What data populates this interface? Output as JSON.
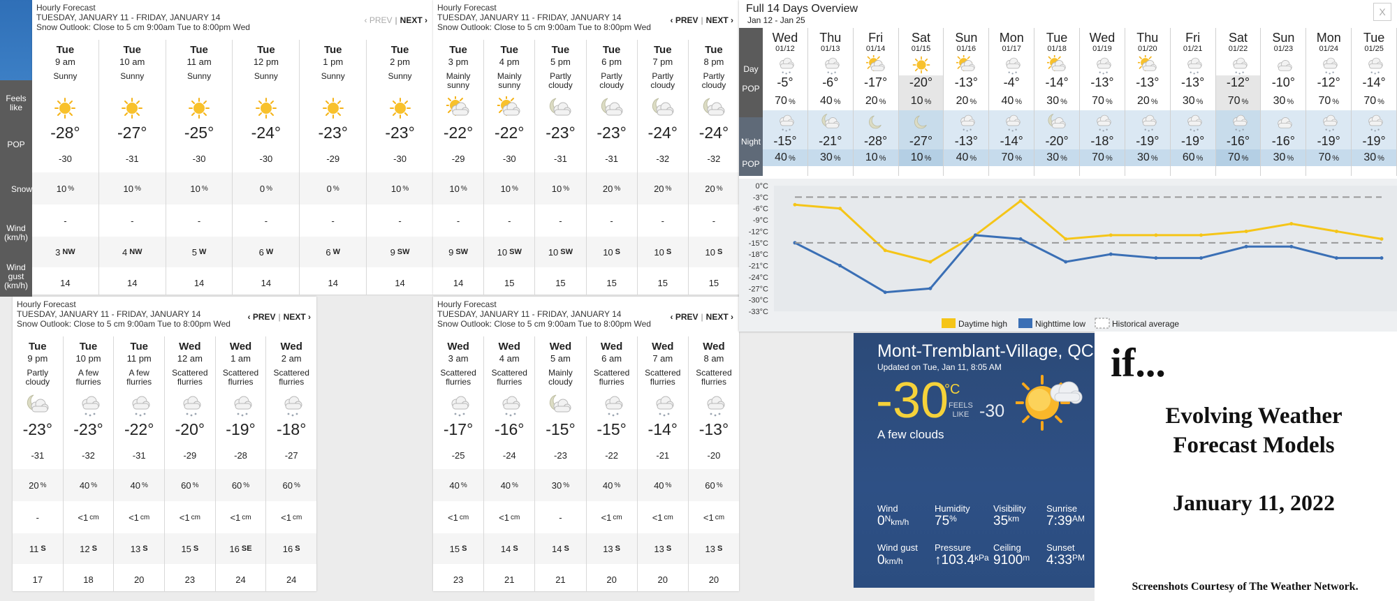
{
  "hourly_panels": [
    {
      "title": "Hourly Forecast",
      "range": "TUESDAY, JANUARY 11 - FRIDAY, JANUARY 14",
      "outlook": "Snow Outlook: Close to 5 cm 9:00am Tue to 8:00pm Wed",
      "prev": "‹ PREV",
      "sep": "|",
      "next": "NEXT ›",
      "hours": [
        {
          "day": "Tue",
          "time": "9 am",
          "cond": "Sunny",
          "icon": "sun-icon",
          "temp": "-28°",
          "feels": "-30",
          "pop": "10",
          "snow": "-",
          "wind_speed": "3",
          "wind_dir": "NW",
          "gust": "14"
        },
        {
          "day": "Tue",
          "time": "10 am",
          "cond": "Sunny",
          "icon": "sun-icon",
          "temp": "-27°",
          "feels": "-31",
          "pop": "10",
          "snow": "-",
          "wind_speed": "4",
          "wind_dir": "NW",
          "gust": "14"
        },
        {
          "day": "Tue",
          "time": "11 am",
          "cond": "Sunny",
          "icon": "sun-icon",
          "temp": "-25°",
          "feels": "-30",
          "pop": "10",
          "snow": "-",
          "wind_speed": "5",
          "wind_dir": "W",
          "gust": "14"
        },
        {
          "day": "Tue",
          "time": "12 pm",
          "cond": "Sunny",
          "icon": "sun-icon",
          "temp": "-24°",
          "feels": "-30",
          "pop": "0",
          "snow": "-",
          "wind_speed": "6",
          "wind_dir": "W",
          "gust": "14"
        },
        {
          "day": "Tue",
          "time": "1 pm",
          "cond": "Sunny",
          "icon": "sun-icon",
          "temp": "-23°",
          "feels": "-29",
          "pop": "0",
          "snow": "-",
          "wind_speed": "6",
          "wind_dir": "W",
          "gust": "14"
        },
        {
          "day": "Tue",
          "time": "2 pm",
          "cond": "Sunny",
          "icon": "sun-icon",
          "temp": "-23°",
          "feels": "-30",
          "pop": "10",
          "snow": "-",
          "wind_speed": "9",
          "wind_dir": "SW",
          "gust": "14"
        }
      ]
    },
    {
      "title": "Hourly Forecast",
      "range": "TUESDAY, JANUARY 11 - FRIDAY, JANUARY 14",
      "outlook": "Snow Outlook: Close to 5 cm 9:00am Tue to 8:00pm Wed",
      "prev": "‹ PREV",
      "sep": "|",
      "next": "NEXT ›",
      "hours": [
        {
          "day": "Tue",
          "time": "3 pm",
          "cond": "Mainly sunny",
          "icon": "sun-cloud-icon",
          "temp": "-22°",
          "feels": "-29",
          "pop": "10",
          "snow": "-",
          "wind_speed": "9",
          "wind_dir": "SW",
          "gust": "14"
        },
        {
          "day": "Tue",
          "time": "4 pm",
          "cond": "Mainly sunny",
          "icon": "sun-cloud-icon",
          "temp": "-22°",
          "feels": "-30",
          "pop": "10",
          "snow": "-",
          "wind_speed": "10",
          "wind_dir": "SW",
          "gust": "15"
        },
        {
          "day": "Tue",
          "time": "5 pm",
          "cond": "Partly cloudy",
          "icon": "moon-cloud-icon",
          "temp": "-23°",
          "feels": "-31",
          "pop": "10",
          "snow": "-",
          "wind_speed": "10",
          "wind_dir": "SW",
          "gust": "15"
        },
        {
          "day": "Tue",
          "time": "6 pm",
          "cond": "Partly cloudy",
          "icon": "moon-cloud-icon",
          "temp": "-23°",
          "feels": "-31",
          "pop": "20",
          "snow": "-",
          "wind_speed": "10",
          "wind_dir": "S",
          "gust": "15"
        },
        {
          "day": "Tue",
          "time": "7 pm",
          "cond": "Partly cloudy",
          "icon": "moon-cloud-icon",
          "temp": "-24°",
          "feels": "-32",
          "pop": "20",
          "snow": "-",
          "wind_speed": "10",
          "wind_dir": "S",
          "gust": "15"
        },
        {
          "day": "Tue",
          "time": "8 pm",
          "cond": "Partly cloudy",
          "icon": "moon-cloud-icon",
          "temp": "-24°",
          "feels": "-32",
          "pop": "20",
          "snow": "-",
          "wind_speed": "10",
          "wind_dir": "S",
          "gust": "15"
        }
      ]
    },
    {
      "title": "Hourly Forecast",
      "range": "TUESDAY, JANUARY 11 - FRIDAY, JANUARY 14",
      "outlook": "Snow Outlook: Close to 5 cm 9:00am Tue to 8:00pm Wed",
      "prev": "‹ PREV",
      "sep": "|",
      "next": "NEXT ›",
      "hours": [
        {
          "day": "Tue",
          "time": "9 pm",
          "cond": "Partly cloudy",
          "icon": "moon-cloud-icon",
          "temp": "-23°",
          "feels": "-31",
          "pop": "20",
          "snow": "-",
          "wind_speed": "11",
          "wind_dir": "S",
          "gust": "17"
        },
        {
          "day": "Tue",
          "time": "10 pm",
          "cond": "A few flurries",
          "icon": "snow-cloud-icon",
          "temp": "-23°",
          "feels": "-32",
          "pop": "40",
          "snow": "<1",
          "wind_speed": "12",
          "wind_dir": "S",
          "gust": "18"
        },
        {
          "day": "Tue",
          "time": "11 pm",
          "cond": "A few flurries",
          "icon": "snow-cloud-icon",
          "temp": "-22°",
          "feels": "-31",
          "pop": "40",
          "snow": "<1",
          "wind_speed": "13",
          "wind_dir": "S",
          "gust": "20"
        },
        {
          "day": "Wed",
          "time": "12 am",
          "cond": "Scattered flurries",
          "icon": "snow-cloud-icon",
          "temp": "-20°",
          "feels": "-29",
          "pop": "60",
          "snow": "<1",
          "wind_speed": "15",
          "wind_dir": "S",
          "gust": "23"
        },
        {
          "day": "Wed",
          "time": "1 am",
          "cond": "Scattered flurries",
          "icon": "snow-cloud-icon",
          "temp": "-19°",
          "feels": "-28",
          "pop": "60",
          "snow": "<1",
          "wind_speed": "16",
          "wind_dir": "SE",
          "gust": "24"
        },
        {
          "day": "Wed",
          "time": "2 am",
          "cond": "Scattered flurries",
          "icon": "snow-cloud-icon",
          "temp": "-18°",
          "feels": "-27",
          "pop": "60",
          "snow": "<1",
          "wind_speed": "16",
          "wind_dir": "S",
          "gust": "24"
        }
      ]
    },
    {
      "title": "Hourly Forecast",
      "range": "TUESDAY, JANUARY 11 - FRIDAY, JANUARY 14",
      "outlook": "Snow Outlook: Close to 5 cm 9:00am Tue to 8:00pm Wed",
      "prev": "‹ PREV",
      "sep": "|",
      "next": "NEXT ›",
      "hours": [
        {
          "day": "Wed",
          "time": "3 am",
          "cond": "Scattered flurries",
          "icon": "snow-cloud-icon",
          "temp": "-17°",
          "feels": "-25",
          "pop": "40",
          "snow": "<1",
          "wind_speed": "15",
          "wind_dir": "S",
          "gust": "23"
        },
        {
          "day": "Wed",
          "time": "4 am",
          "cond": "Scattered flurries",
          "icon": "snow-cloud-icon",
          "temp": "-16°",
          "feels": "-24",
          "pop": "40",
          "snow": "<1",
          "wind_speed": "14",
          "wind_dir": "S",
          "gust": "21"
        },
        {
          "day": "Wed",
          "time": "5 am",
          "cond": "Mainly cloudy",
          "icon": "moon-cloud-icon",
          "temp": "-15°",
          "feels": "-23",
          "pop": "30",
          "snow": "-",
          "wind_speed": "14",
          "wind_dir": "S",
          "gust": "21"
        },
        {
          "day": "Wed",
          "time": "6 am",
          "cond": "Scattered flurries",
          "icon": "snow-cloud-icon",
          "temp": "-15°",
          "feels": "-22",
          "pop": "40",
          "snow": "<1",
          "wind_speed": "13",
          "wind_dir": "S",
          "gust": "20"
        },
        {
          "day": "Wed",
          "time": "7 am",
          "cond": "Scattered flurries",
          "icon": "snow-cloud-icon",
          "temp": "-14°",
          "feels": "-21",
          "pop": "40",
          "snow": "<1",
          "wind_speed": "13",
          "wind_dir": "S",
          "gust": "20"
        },
        {
          "day": "Wed",
          "time": "8 am",
          "cond": "Scattered flurries",
          "icon": "snow-cloud-icon",
          "temp": "-13°",
          "feels": "-20",
          "pop": "60",
          "snow": "<1",
          "wind_speed": "13",
          "wind_dir": "S",
          "gust": "20"
        }
      ]
    }
  ],
  "units": {
    "pct": "%",
    "snow": "cm"
  },
  "row_labels": {
    "feels": "Feels like",
    "pop": "POP",
    "snow": "Snow",
    "wind": "Wind (km/h)",
    "gust": "Wind gust (km/h)"
  },
  "overview": {
    "title": "Full 14 Days Overview",
    "range": "Jan 12 - Jan 25",
    "close": "X",
    "labels": {
      "day": "Day",
      "pop": "POP",
      "night": "Night",
      "npop": "POP"
    },
    "days": [
      {
        "name": "Wed",
        "date": "01/12",
        "dicon": "snow-cloud-icon",
        "high": "-5°",
        "dpop": "70",
        "nicon": "snow-cloud-icon",
        "low": "-15°",
        "npop": "40"
      },
      {
        "name": "Thu",
        "date": "01/13",
        "dicon": "snow-cloud-icon",
        "high": "-6°",
        "dpop": "40",
        "nicon": "moon-cloud-icon",
        "low": "-21°",
        "npop": "30"
      },
      {
        "name": "Fri",
        "date": "01/14",
        "dicon": "sun-cloud-icon",
        "high": "-17°",
        "dpop": "20",
        "nicon": "moon-icon",
        "low": "-28°",
        "npop": "10"
      },
      {
        "name": "Sat",
        "date": "01/15",
        "dicon": "sun-icon",
        "high": "-20°",
        "dpop": "10",
        "nicon": "moon-icon",
        "low": "-27°",
        "npop": "10"
      },
      {
        "name": "Sun",
        "date": "01/16",
        "dicon": "sun-cloud-icon",
        "high": "-13°",
        "dpop": "20",
        "nicon": "snow-cloud-icon",
        "low": "-13°",
        "npop": "40"
      },
      {
        "name": "Mon",
        "date": "01/17",
        "dicon": "snow-cloud-icon",
        "high": "-4°",
        "dpop": "40",
        "nicon": "snow-cloud-icon",
        "low": "-14°",
        "npop": "70"
      },
      {
        "name": "Tue",
        "date": "01/18",
        "dicon": "sun-cloud-icon",
        "high": "-14°",
        "dpop": "30",
        "nicon": "moon-cloud-icon",
        "low": "-20°",
        "npop": "30"
      },
      {
        "name": "Wed",
        "date": "01/19",
        "dicon": "snow-cloud-icon",
        "high": "-13°",
        "dpop": "70",
        "nicon": "snow-cloud-icon",
        "low": "-18°",
        "npop": "70"
      },
      {
        "name": "Thu",
        "date": "01/20",
        "dicon": "sun-cloud-icon",
        "high": "-13°",
        "dpop": "20",
        "nicon": "snow-cloud-icon",
        "low": "-19°",
        "npop": "30"
      },
      {
        "name": "Fri",
        "date": "01/21",
        "dicon": "snow-cloud-icon",
        "high": "-13°",
        "dpop": "30",
        "nicon": "snow-cloud-icon",
        "low": "-19°",
        "npop": "60"
      },
      {
        "name": "Sat",
        "date": "01/22",
        "dicon": "snow-cloud-icon",
        "high": "-12°",
        "dpop": "70",
        "nicon": "snow-cloud-icon",
        "low": "-16°",
        "npop": "70"
      },
      {
        "name": "Sun",
        "date": "01/23",
        "dicon": "cloud-icon",
        "high": "-10°",
        "dpop": "30",
        "nicon": "cloud-icon",
        "low": "-16°",
        "npop": "30"
      },
      {
        "name": "Mon",
        "date": "01/24",
        "dicon": "snow-cloud-icon",
        "high": "-12°",
        "dpop": "70",
        "nicon": "snow-cloud-icon",
        "low": "-19°",
        "npop": "70"
      },
      {
        "name": "Tue",
        "date": "01/25",
        "dicon": "snow-cloud-icon",
        "high": "-14°",
        "dpop": "70",
        "nicon": "snow-cloud-icon",
        "low": "-19°",
        "npop": "30"
      }
    ]
  },
  "chart_data": {
    "type": "line",
    "x": [
      "01/12",
      "01/13",
      "01/14",
      "01/15",
      "01/16",
      "01/17",
      "01/18",
      "01/19",
      "01/20",
      "01/21",
      "01/22",
      "01/23",
      "01/24",
      "01/25"
    ],
    "series": [
      {
        "name": "Daytime high",
        "color": "#f5c518",
        "values": [
          -5,
          -6,
          -17,
          -20,
          -13,
          -4,
          -14,
          -13,
          -13,
          -13,
          -12,
          -10,
          -12,
          -14
        ]
      },
      {
        "name": "Nighttime low",
        "color": "#3a6fb5",
        "values": [
          -15,
          -21,
          -28,
          -27,
          -13,
          -14,
          -20,
          -18,
          -19,
          -19,
          -16,
          -16,
          -19,
          -19
        ]
      },
      {
        "name": "Historical average",
        "color": "#999999",
        "values": [
          -3,
          -3,
          -3,
          -3,
          -3,
          -3,
          -3,
          -3,
          -3,
          -3,
          -3,
          -3,
          -3,
          -3
        ],
        "style": "dashed"
      },
      {
        "name": "",
        "color": "#999999",
        "values": [
          -15,
          -15,
          -15,
          -15,
          -15,
          -15,
          -15,
          -15,
          -15,
          -15,
          -15,
          -15,
          -15,
          -15
        ],
        "style": "dashed"
      }
    ],
    "yticks": [
      "0°C",
      "-3°C",
      "-6°C",
      "-9°C",
      "-12°C",
      "-15°C",
      "-18°C",
      "-21°C",
      "-24°C",
      "-27°C",
      "-30°C",
      "-33°C"
    ],
    "ylim": [
      -33,
      0
    ],
    "grid": false,
    "legend": "bottom",
    "legend_items": [
      "Daytime high",
      "Nighttime low",
      "Historical average"
    ]
  },
  "current": {
    "city": "Mont-Tremblant-Village, QC",
    "updated": "Updated on Tue, Jan 11, 8:05 AM",
    "temp": "-30",
    "deg": "°C",
    "feels_label1": "FEELS",
    "feels_label2": "LIKE",
    "feels": "-30",
    "cond": "A few clouds",
    "wind": {
      "label": "Wind",
      "value": "0",
      "dir": "N",
      "unit": "km/h"
    },
    "humidity": {
      "label": "Humidity",
      "value": "75",
      "unit": "%"
    },
    "visibility": {
      "label": "Visibility",
      "value": "35",
      "unit": "km"
    },
    "sunrise": {
      "label": "Sunrise",
      "value": "7:39",
      "unit": "AM"
    },
    "gust": {
      "label": "Wind gust",
      "value": "0",
      "unit": "km/h"
    },
    "pressure": {
      "label": "Pressure",
      "arrow": "↑",
      "value": "103.4",
      "unit": "kPa"
    },
    "ceiling": {
      "label": "Ceiling",
      "value": "9100",
      "unit": "m"
    },
    "sunset": {
      "label": "Sunset",
      "value": "4:33",
      "unit": "PM"
    }
  },
  "side_text": {
    "if": "if...",
    "heading1": "Evolving Weather",
    "heading2": "Forecast Models",
    "date": "January 11, 2022",
    "credit": "Screenshots Courtesy of The Weather Network."
  }
}
